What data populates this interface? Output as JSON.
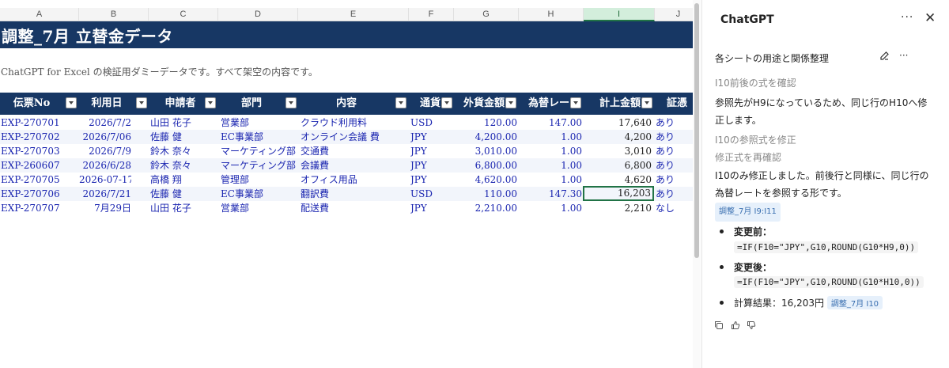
{
  "columns": [
    "A",
    "B",
    "C",
    "D",
    "E",
    "F",
    "G",
    "H",
    "I",
    "J"
  ],
  "sheet": {
    "title": "調整_7月 立替金データ",
    "note": "ChatGPT for Excel の検証用ダミーデータです。すべて架空の内容です。",
    "headers": [
      "伝票No",
      "利用日",
      "申請者",
      "部門",
      "内容",
      "通貨",
      "外貨金額",
      "為替レー",
      "計上金額",
      "証憑"
    ],
    "rows": [
      [
        "EXP-270701",
        "2026/7/2",
        "山田 花子",
        "営業部",
        "クラウド利用料",
        "USD",
        "120.00",
        "147.00",
        "17,640",
        "あり"
      ],
      [
        "EXP-270702",
        "2026/7/06",
        "佐藤 健",
        "EC事業部",
        "オンライン会議 費",
        "JPY",
        "4,200.00",
        "1.00",
        "4,200",
        "あり"
      ],
      [
        "EXP-270703",
        "2026/7/9",
        "鈴木 奈々",
        "マーケティング部",
        "交通費",
        "JPY",
        "3,010.00",
        "1.00",
        "3,010",
        "あり"
      ],
      [
        "EXP-260607",
        "2026/6/28",
        "鈴木 奈々",
        "マーケティング部",
        "会議費",
        "JPY",
        "6,800.00",
        "1.00",
        "6,800",
        "あり"
      ],
      [
        "EXP-270705",
        "2026-07-17",
        "高橋 翔",
        "管理部",
        "オフィス用品",
        "JPY",
        "4,620.00",
        "1.00",
        "4,620",
        "あり"
      ],
      [
        "EXP-270706",
        "2026/7/21",
        "佐藤 健",
        "EC事業部",
        "翻訳費",
        "USD",
        "110.00",
        "147.30",
        "16,203",
        "あり"
      ],
      [
        "EXP-270707",
        "7月29日",
        "山田 花子",
        "営業部",
        "配送費",
        "JPY",
        "2,210.00",
        "1.00",
        "2,210",
        "なし"
      ]
    ]
  },
  "panel": {
    "title": "ChatGPT",
    "more": "···",
    "close": "✕",
    "chat_title": "各シートの用途と関係整理",
    "chat_more": "···",
    "step1": "I10前後の式を確認",
    "msg1": "参照先がH9になっているため、同じ行のH10へ修正します。",
    "step2": "I10の参照式を修正",
    "step3": "修正式を再確認",
    "msg2": "I10のみ修正しました。前後行と同様に、同じ行の為替レートを参照する形です。",
    "chip1": "調整_7月 I9:I11",
    "before_label": "変更前：",
    "before_code": "=IF(F10=\"JPY\",G10,ROUND(G10*H9,0))",
    "after_label": "変更後：",
    "after_code": "=IF(F10=\"JPY\",G10,ROUND(G10*H10,0))",
    "result_label": "計算結果：16,203円",
    "chip2": "調整_7月 I10"
  }
}
